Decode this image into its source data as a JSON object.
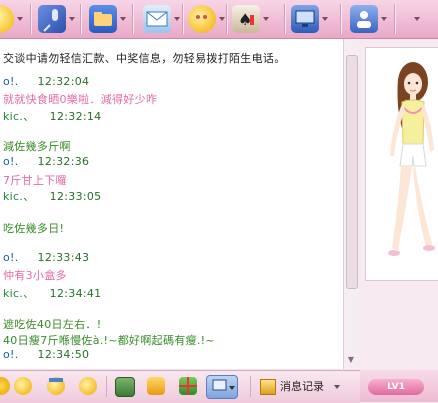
{
  "toolbar": {
    "icons": [
      "smiley-icon",
      "microphone-icon",
      "folder-icon",
      "mail-icon",
      "chat-bubble-icon",
      "games-icon",
      "monitor-icon",
      "user-info-icon"
    ]
  },
  "chat": {
    "notice": "交谈中请勿轻信汇款、中奖信息，勿轻易拨打陌生电话。",
    "lines": [
      {
        "name": "o!.",
        "time": "12:32:04"
      },
      {
        "text": "就就快食晒0樂啦．減得好少咋"
      },
      {
        "name": "kic.、",
        "time": "12:32:14"
      },
      {
        "text": "減佐幾多斤啊"
      },
      {
        "name": "o!.",
        "time": "12:32:36"
      },
      {
        "text": "7斤甘上下囉"
      },
      {
        "name": "kic.、",
        "time": "12:33:05"
      },
      {
        "text": "吃佐幾多日!"
      },
      {
        "name": "o!.",
        "time": "12:33:43"
      },
      {
        "text": "仲有3小盒多"
      },
      {
        "name": "kic.、",
        "time": "12:34:41"
      },
      {
        "text": "遮吃佐40日左右．!"
      },
      {
        "text": "40日瘦7斤喺慢佐à.!~都好啊起碼有瘦.!~"
      },
      {
        "name": "o!.",
        "time": "12:34:50"
      }
    ]
  },
  "bottom": {
    "icons": [
      "emoticon-icon",
      "magic-face-icon",
      "wink-icon",
      "picture-icon",
      "paste-icon",
      "gift-icon",
      "screenshot-icon"
    ],
    "history_label": "消息记录"
  },
  "right": {
    "level_badge": "LV1"
  },
  "colors": {
    "toolbar": "#e9a8c6",
    "accent_pink": "#e86aa6",
    "time_green": "#2a6f2a",
    "name_blue": "#1a5fb4"
  }
}
